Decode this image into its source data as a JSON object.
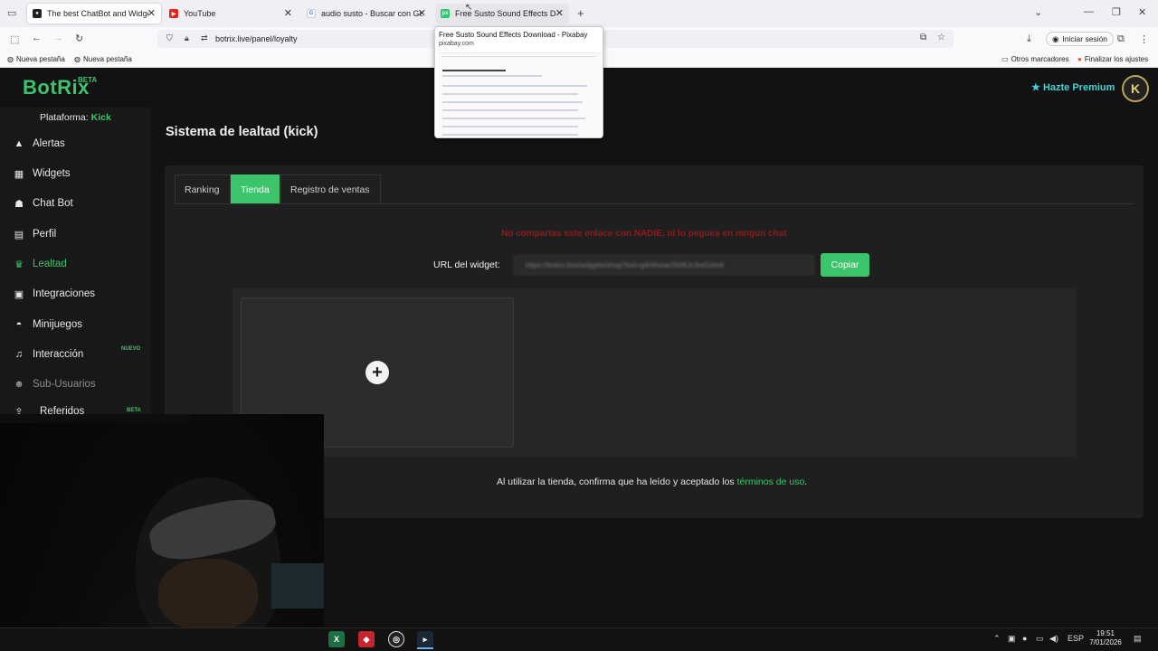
{
  "browser": {
    "tabs": [
      {
        "title": "The best ChatBot and Widgets f",
        "active": true
      },
      {
        "title": "YouTube",
        "active": false
      },
      {
        "title": "audio susto - Buscar con Googl",
        "active": false
      },
      {
        "title": "Free Susto Sound Effects Down",
        "active": false
      }
    ],
    "new_tab": "+",
    "url": "botrix.live/panel/loyalty",
    "sign_in": "Iniciar sesión",
    "bookmarks": {
      "left": [
        "Nueva pestaña",
        "Nueva pestaña"
      ],
      "other": "Otros marcadores",
      "finish": "Finalizar los ajustes"
    },
    "preview": {
      "title": "Free Susto Sound Effects Download - Pixabay",
      "domain": "pixabay.com"
    }
  },
  "app": {
    "logo": "BotRix",
    "logo_badge": "BETA",
    "premium": "Hazte Premium",
    "platform_label": "Plataforma:",
    "platform_value": "Kick",
    "sidebar": [
      {
        "label": "Alertas",
        "icon": "warning-icon"
      },
      {
        "label": "Widgets",
        "icon": "grid-icon"
      },
      {
        "label": "Chat Bot",
        "icon": "robot-icon"
      },
      {
        "label": "Perfil",
        "icon": "id-card-icon"
      },
      {
        "label": "Lealtad",
        "icon": "trophy-icon",
        "active": true
      },
      {
        "label": "Integraciones",
        "icon": "list-icon"
      },
      {
        "label": "Minijuegos",
        "icon": "gamepad-icon"
      },
      {
        "label": "Interacción",
        "icon": "music-icon",
        "badge": "NUEVO"
      },
      {
        "label": "Sub-Usuarios",
        "icon": "users-icon",
        "muted": true
      },
      {
        "label": "Referidos",
        "icon": "share-icon",
        "badge": "BETA"
      }
    ],
    "page_title": "Sistema de lealtad (kick)",
    "tabs": [
      "Ranking",
      "Tienda",
      "Registro de ventas"
    ],
    "active_tab": "Tienda",
    "warning": "No compartas este enlace con NADIE, ni lo pegues en ningún chat",
    "widget_url_label": "URL del widget:",
    "widget_url_value": "https://botrix.live/widgets/shop?bid=g4rWsIaeSW8Jc3mGdm6",
    "copy_label": "Copiar",
    "terms_prefix": "Al utilizar la tienda, confirma que ha leído y aceptado los ",
    "terms_link": "términos de uso",
    "terms_suffix": "."
  },
  "taskbar": {
    "lang": "ESP",
    "time": "19:51",
    "date": "7/01/2026"
  },
  "colors": {
    "accent": "#3cc46a",
    "warning": "#8f1b1b",
    "premium": "#46d2d8"
  }
}
